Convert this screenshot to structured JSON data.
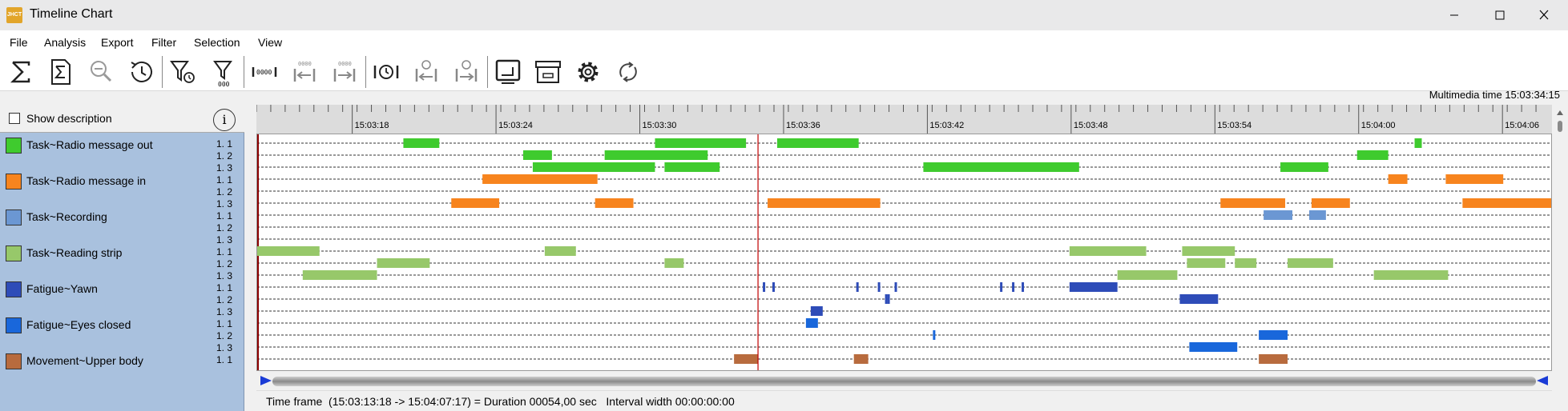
{
  "window": {
    "app_icon_text": "JHCT",
    "title": "Timeline Chart"
  },
  "menu": [
    "File",
    "Analysis",
    "Export",
    "Filter",
    "Selection",
    "View"
  ],
  "toolbar_icons": [
    "sigma-icon",
    "sigma-document-icon",
    "zoom-out-icon",
    "history-icon",
    "filter-time-icon",
    "filter-values-icon",
    "interval-width-icon",
    "jump-back-icon",
    "jump-forward-icon",
    "sync-time-icon",
    "step-back-icon",
    "step-forward-icon",
    "screen-icon",
    "archive-icon",
    "settings-icon",
    "refresh-icon"
  ],
  "multimedia_time": "Multimedia time 15:03:34:15",
  "show_description_label": "Show description",
  "info_icon": "i",
  "groups": [
    {
      "name": "Task~Radio message out",
      "color": "#3fcb2e",
      "tracks": [
        "1.  1",
        "1.  2",
        "1.  3"
      ]
    },
    {
      "name": "Task~Radio message in",
      "color": "#f7841e",
      "tracks": [
        "1.  1",
        "1.  2",
        "1.  3"
      ]
    },
    {
      "name": "Task~Recording",
      "color": "#6b97d3",
      "tracks": [
        "1.  1",
        "1.  2",
        "1.  3"
      ]
    },
    {
      "name": "Task~Reading strip",
      "color": "#97c86a",
      "tracks": [
        "1.  1",
        "1.  2",
        "1.  3"
      ]
    },
    {
      "name": "Fatigue~Yawn",
      "color": "#2e4cb8",
      "tracks": [
        "1.  1",
        "1.  2",
        "1.  3"
      ]
    },
    {
      "name": "Fatigue~Eyes closed",
      "color": "#1967db",
      "tracks": [
        "1.  1",
        "1.  2",
        "1.  3"
      ]
    },
    {
      "name": "Movement~Upper body",
      "color": "#b86b3e",
      "tracks": [
        "1.  1"
      ]
    }
  ],
  "time_axis": {
    "start_s": 0,
    "end_s": 54,
    "start_label": "15:03:13:18",
    "end_label": "15:04:07:17",
    "ticks": [
      {
        "t": 4,
        "label": "15:03:18"
      },
      {
        "t": 10,
        "label": "15:03:24"
      },
      {
        "t": 16,
        "label": "15:03:30"
      },
      {
        "t": 22,
        "label": "15:03:36"
      },
      {
        "t": 28,
        "label": "15:03:42"
      },
      {
        "t": 34,
        "label": "15:03:48"
      },
      {
        "t": 40,
        "label": "15:03:54"
      },
      {
        "t": 46,
        "label": "15:04:00"
      },
      {
        "t": 52,
        "label": "15:04:06"
      }
    ],
    "cursor_t": 20.9
  },
  "chart_data": {
    "type": "timeline",
    "unit": "seconds from 15:03:13:18",
    "series": [
      {
        "group": 0,
        "track": 0,
        "intervals": [
          [
            6.1,
            7.6
          ],
          [
            16.6,
            20.4
          ],
          [
            21.7,
            25.1
          ],
          [
            48.3,
            48.6
          ]
        ]
      },
      {
        "group": 0,
        "track": 1,
        "intervals": [
          [
            11.1,
            12.3
          ],
          [
            14.5,
            18.8
          ],
          [
            45.9,
            47.2
          ]
        ]
      },
      {
        "group": 0,
        "track": 2,
        "intervals": [
          [
            11.5,
            16.6
          ],
          [
            17.0,
            19.3
          ],
          [
            27.8,
            34.3
          ],
          [
            42.7,
            44.7
          ]
        ]
      },
      {
        "group": 1,
        "track": 0,
        "intervals": [
          [
            9.4,
            14.2
          ],
          [
            47.2,
            48.0
          ],
          [
            49.6,
            52.0
          ]
        ]
      },
      {
        "group": 1,
        "track": 1,
        "intervals": []
      },
      {
        "group": 1,
        "track": 2,
        "intervals": [
          [
            8.1,
            10.1
          ],
          [
            14.1,
            15.7
          ],
          [
            21.3,
            26.0
          ],
          [
            40.2,
            42.9
          ],
          [
            44.0,
            45.6
          ],
          [
            50.3,
            54.0
          ]
        ]
      },
      {
        "group": 2,
        "track": 0,
        "intervals": [
          [
            42.0,
            43.2
          ],
          [
            43.9,
            44.6
          ]
        ]
      },
      {
        "group": 2,
        "track": 1,
        "intervals": []
      },
      {
        "group": 2,
        "track": 2,
        "intervals": []
      },
      {
        "group": 3,
        "track": 0,
        "intervals": [
          [
            0.0,
            2.6
          ],
          [
            12.0,
            13.3
          ],
          [
            33.9,
            37.1
          ],
          [
            38.6,
            40.8
          ]
        ]
      },
      {
        "group": 3,
        "track": 1,
        "intervals": [
          [
            5.0,
            7.2
          ],
          [
            17.0,
            17.8
          ],
          [
            38.8,
            40.4
          ],
          [
            40.8,
            41.7
          ],
          [
            43.0,
            44.9
          ]
        ]
      },
      {
        "group": 3,
        "track": 2,
        "intervals": [
          [
            1.9,
            5.0
          ],
          [
            35.9,
            38.4
          ],
          [
            46.6,
            49.7
          ]
        ]
      },
      {
        "group": 4,
        "track": 0,
        "intervals": [
          [
            21.1,
            21.2
          ],
          [
            21.5,
            21.6
          ],
          [
            25.0,
            25.1
          ],
          [
            25.9,
            26.0
          ],
          [
            26.6,
            26.7
          ],
          [
            31.0,
            31.1
          ],
          [
            31.5,
            31.6
          ],
          [
            31.9,
            32.0
          ],
          [
            33.9,
            35.9
          ]
        ]
      },
      {
        "group": 4,
        "track": 1,
        "intervals": [
          [
            26.2,
            26.3
          ],
          [
            26.3,
            26.4
          ],
          [
            38.5,
            40.1
          ]
        ]
      },
      {
        "group": 4,
        "track": 2,
        "intervals": [
          [
            23.1,
            23.6
          ]
        ]
      },
      {
        "group": 5,
        "track": 0,
        "intervals": [
          [
            22.9,
            23.4
          ]
        ]
      },
      {
        "group": 5,
        "track": 1,
        "intervals": [
          [
            28.2,
            28.3
          ],
          [
            41.8,
            43.0
          ]
        ]
      },
      {
        "group": 5,
        "track": 2,
        "intervals": [
          [
            38.9,
            40.9
          ]
        ]
      },
      {
        "group": 6,
        "track": 0,
        "intervals": [
          [
            19.9,
            20.9
          ],
          [
            24.9,
            25.5
          ],
          [
            41.8,
            43.0
          ]
        ]
      }
    ]
  },
  "status": "Time frame  (15:03:13:18 -> 15:04:07:17) = Duration 00054,00 sec   Interval width 00:00:00:00"
}
